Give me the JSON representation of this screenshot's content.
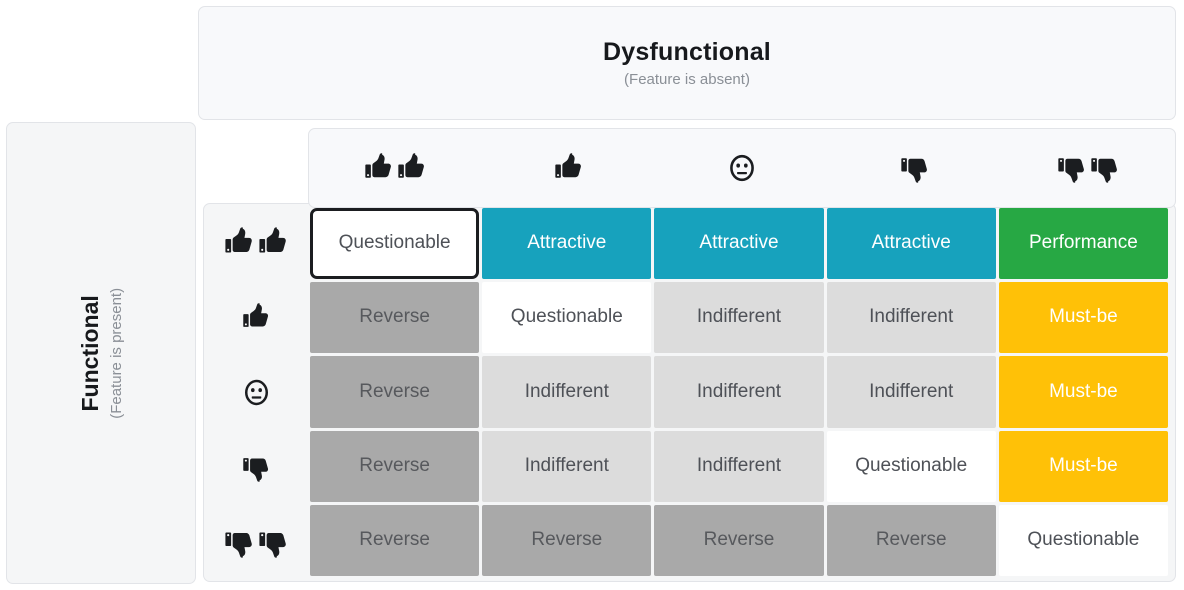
{
  "axes": {
    "horizontal": {
      "title": "Dysfunctional",
      "subtitle": "(Feature is absent)"
    },
    "vertical": {
      "title": "Functional",
      "subtitle": "(Feature is present)"
    }
  },
  "column_headers": [
    {
      "icon": "thumbs-up-double-icon",
      "meaning": "I like it"
    },
    {
      "icon": "thumbs-up-icon",
      "meaning": "I expect it"
    },
    {
      "icon": "neutral-face-icon",
      "meaning": "I am neutral"
    },
    {
      "icon": "thumbs-down-icon",
      "meaning": "I can tolerate it"
    },
    {
      "icon": "thumbs-down-double-icon",
      "meaning": "I dislike it"
    }
  ],
  "row_headers": [
    {
      "icon": "thumbs-up-double-icon",
      "meaning": "I like it"
    },
    {
      "icon": "thumbs-up-icon",
      "meaning": "I expect it"
    },
    {
      "icon": "neutral-face-icon",
      "meaning": "I am neutral"
    },
    {
      "icon": "thumbs-down-icon",
      "meaning": "I can tolerate it"
    },
    {
      "icon": "thumbs-down-double-icon",
      "meaning": "I dislike it"
    }
  ],
  "legend_colors": {
    "attractive": "#17a2bd",
    "performance": "#27a844",
    "must_be": "#ffc107",
    "reverse": "#a9a9a9",
    "indifferent": "#dcdcdc",
    "questionable": "#ffffff",
    "selected_outline": "#1b1d20"
  },
  "chart_data": {
    "type": "table",
    "title": "Kano Model Evaluation Table",
    "xlabel": "Dysfunctional (Feature is absent)",
    "ylabel": "Functional (Feature is present)",
    "categories": [
      "I like it",
      "I expect it",
      "I am neutral",
      "I can tolerate it",
      "I dislike it"
    ],
    "rows": [
      "I like it",
      "I expect it",
      "I am neutral",
      "I can tolerate it",
      "I dislike it"
    ],
    "values": [
      [
        "Questionable",
        "Attractive",
        "Attractive",
        "Attractive",
        "Performance"
      ],
      [
        "Reverse",
        "Questionable",
        "Indifferent",
        "Indifferent",
        "Must-be"
      ],
      [
        "Reverse",
        "Indifferent",
        "Indifferent",
        "Indifferent",
        "Must-be"
      ],
      [
        "Reverse",
        "Indifferent",
        "Indifferent",
        "Questionable",
        "Must-be"
      ],
      [
        "Reverse",
        "Reverse",
        "Reverse",
        "Reverse",
        "Questionable"
      ]
    ]
  },
  "matrix": [
    [
      {
        "label": "Questionable",
        "kind": "questionable",
        "selected": true
      },
      {
        "label": "Attractive",
        "kind": "attractive",
        "selected": false
      },
      {
        "label": "Attractive",
        "kind": "attractive",
        "selected": false
      },
      {
        "label": "Attractive",
        "kind": "attractive",
        "selected": false
      },
      {
        "label": "Performance",
        "kind": "performance",
        "selected": false
      }
    ],
    [
      {
        "label": "Reverse",
        "kind": "reverse",
        "selected": false
      },
      {
        "label": "Questionable",
        "kind": "questionable",
        "selected": false
      },
      {
        "label": "Indifferent",
        "kind": "indifferent",
        "selected": false
      },
      {
        "label": "Indifferent",
        "kind": "indifferent",
        "selected": false
      },
      {
        "label": "Must-be",
        "kind": "mustbe",
        "selected": false
      }
    ],
    [
      {
        "label": "Reverse",
        "kind": "reverse",
        "selected": false
      },
      {
        "label": "Indifferent",
        "kind": "indifferent",
        "selected": false
      },
      {
        "label": "Indifferent",
        "kind": "indifferent",
        "selected": false
      },
      {
        "label": "Indifferent",
        "kind": "indifferent",
        "selected": false
      },
      {
        "label": "Must-be",
        "kind": "mustbe",
        "selected": false
      }
    ],
    [
      {
        "label": "Reverse",
        "kind": "reverse",
        "selected": false
      },
      {
        "label": "Indifferent",
        "kind": "indifferent",
        "selected": false
      },
      {
        "label": "Indifferent",
        "kind": "indifferent",
        "selected": false
      },
      {
        "label": "Questionable",
        "kind": "questionable",
        "selected": false
      },
      {
        "label": "Must-be",
        "kind": "mustbe",
        "selected": false
      }
    ],
    [
      {
        "label": "Reverse",
        "kind": "reverse",
        "selected": false
      },
      {
        "label": "Reverse",
        "kind": "reverse",
        "selected": false
      },
      {
        "label": "Reverse",
        "kind": "reverse",
        "selected": false
      },
      {
        "label": "Reverse",
        "kind": "reverse",
        "selected": false
      },
      {
        "label": "Questionable",
        "kind": "questionable",
        "selected": false
      }
    ]
  ]
}
